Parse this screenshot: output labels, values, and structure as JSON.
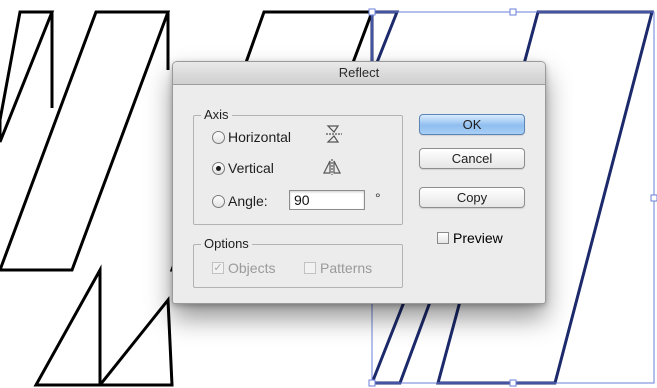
{
  "dialog": {
    "title": "Reflect",
    "axis_group": {
      "label": "Axis",
      "options": [
        {
          "label": "Horizontal",
          "selected": false,
          "icon": "reflect-horizontal-icon"
        },
        {
          "label": "Vertical",
          "selected": true,
          "icon": "reflect-vertical-icon"
        },
        {
          "label": "Angle:",
          "selected": false
        }
      ],
      "angle_value": "90",
      "angle_unit": "°"
    },
    "options_group": {
      "label": "Options",
      "objects": {
        "label": "Objects",
        "checked": true,
        "enabled": false
      },
      "patterns": {
        "label": "Patterns",
        "checked": false,
        "enabled": false
      }
    },
    "buttons": {
      "ok": "OK",
      "cancel": "Cancel",
      "copy": "Copy"
    },
    "preview": {
      "label": "Preview",
      "checked": false
    }
  },
  "colors": {
    "selection": "#6b7fd8",
    "reflected_stroke": "#1c2a6b",
    "stroke": "#000000",
    "default_button": "#8fbef0"
  }
}
